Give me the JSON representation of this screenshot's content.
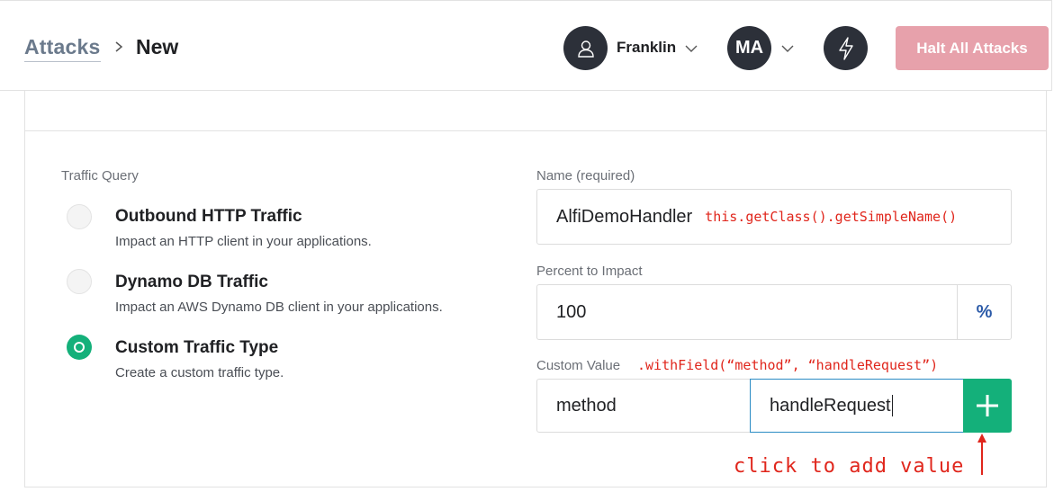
{
  "breadcrumb": {
    "parent": "Attacks",
    "current": "New"
  },
  "header": {
    "user_name": "Franklin",
    "org_initials": "MA",
    "halt_button": "Halt All Attacks",
    "halt_color": "#e7a1ab"
  },
  "icons": {
    "user": "user-icon",
    "chevron": "chevron-down-icon",
    "bolt": "lightning-bolt-icon",
    "plus": "plus-icon",
    "arrow": "arrow-up-icon"
  },
  "traffic_query": {
    "label": "Traffic Query",
    "options": [
      {
        "title": "Outbound HTTP Traffic",
        "description": "Impact an HTTP client in your applications.",
        "selected": false
      },
      {
        "title": "Dynamo DB Traffic",
        "description": "Impact an AWS Dynamo DB client in your applications.",
        "selected": false
      },
      {
        "title": "Custom Traffic Type",
        "description": "Create a custom traffic type.",
        "selected": true
      }
    ]
  },
  "form": {
    "name_label": "Name (required)",
    "name_value": "AlfiDemoHandler",
    "name_annotation": "this.getClass().getSimpleName()",
    "percent_label": "Percent to Impact",
    "percent_value": "100",
    "percent_unit": "%",
    "custom_label": "Custom Value",
    "custom_annotation": ".withField(“method”, “handleRequest”)",
    "custom_key": "method",
    "custom_value": "handleRequest",
    "add_hint": "click to add value"
  },
  "colors": {
    "accent": "#14b07a",
    "annotation": "#e0261c",
    "avatar_bg": "#2c3039"
  }
}
